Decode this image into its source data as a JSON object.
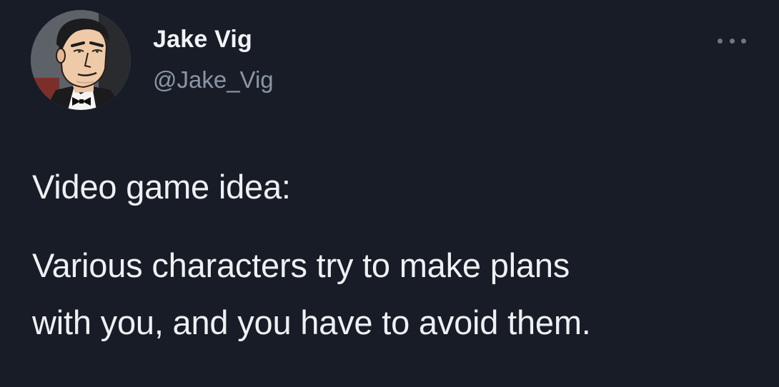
{
  "tweet": {
    "author": {
      "name": "Jake Vig",
      "handle": "@Jake_Vig",
      "avatar_icon": "cartoon-man-tuxedo-avatar"
    },
    "more_icon": "more-options-icon",
    "text_lines": [
      "Video game idea:",
      "Various characters try to make plans",
      "with you, and you have to avoid them."
    ]
  },
  "colors": {
    "background": "#171c27",
    "primary_text": "#eef0f2",
    "secondary_text": "#8b96a3"
  }
}
